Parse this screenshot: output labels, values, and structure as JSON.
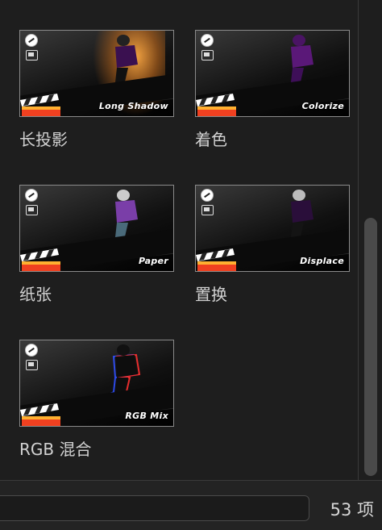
{
  "effects": [
    {
      "label": "长投影",
      "thumb_text": "Long Shadow",
      "tint": "#e89a3a",
      "figure": "#1a1a1a"
    },
    {
      "label": "着色",
      "thumb_text": "Colorize",
      "tint": "#6a1a8a",
      "figure": "#5a1878"
    },
    {
      "label": "纸张",
      "thumb_text": "Paper",
      "tint": "#555555",
      "figure": "#7a3ea8"
    },
    {
      "label": "置换",
      "thumb_text": "Displace",
      "tint": "#2a2a2a",
      "figure": "#1c1c1c"
    },
    {
      "label": "RGB 混合",
      "thumb_text": "RGB Mix",
      "tint": "#1a2a6a",
      "figure": "#0d0d0d"
    }
  ],
  "footer": {
    "search_placeholder": "",
    "count_label": "53 项"
  }
}
